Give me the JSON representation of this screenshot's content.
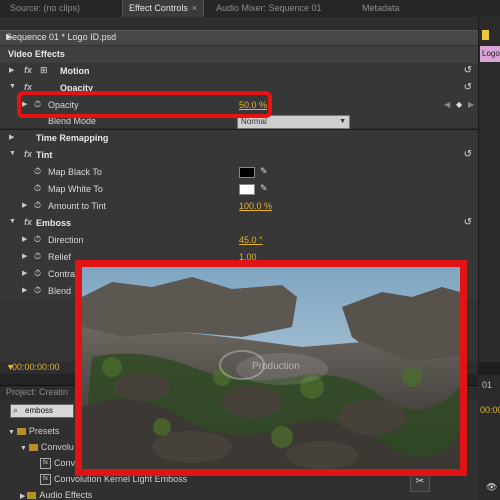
{
  "tabs": [
    {
      "label": "Source: (no clips)",
      "active": false
    },
    {
      "label": "Effect Controls",
      "active": true,
      "close": "×"
    },
    {
      "label": "Audio Mixer: Sequence 01",
      "active": false
    },
    {
      "label": "Metadata",
      "active": false
    }
  ],
  "sequence_header": {
    "label": "Sequence 01 * Logo ID.psd",
    "arrow": "▶"
  },
  "timeline_clip_label": "Logo",
  "video_effects_header": "Video Effects",
  "effects": {
    "motion": "Motion",
    "opacity_group": "Opacity",
    "opacity": {
      "label": "Opacity",
      "value": "50.0 %"
    },
    "blend_mode": {
      "label": "Blend Mode",
      "value": "Normal"
    },
    "time_remapping": "Time Remapping",
    "tint": "Tint",
    "map_black": "Map Black To",
    "map_white": "Map White To",
    "amount_to_tint": {
      "label": "Amount to Tint",
      "value": "100.0 %"
    },
    "emboss": "Emboss",
    "direction": {
      "label": "Direction",
      "value": "45.0 °"
    },
    "relief": {
      "label": "Relief",
      "value": "1.00"
    },
    "contrast": "Contra",
    "blend": "Blend"
  },
  "colors": {
    "accent_value": "#e9b528",
    "highlight": "#e81212",
    "map_black": "#000000",
    "map_white": "#ffffff"
  },
  "timecode": "00:00:00:00",
  "project_tab": "Project: Creatin",
  "search_value": "emboss",
  "project_tree": {
    "presets": "Presets",
    "convolution_folder": "Convolu",
    "convolution_item": "Convolu",
    "convolution_kernel": "Convolution Kernel Light Emboss",
    "audio_effects": "Audio Effects"
  },
  "right_panel": {
    "tab": "01",
    "timecode": "00:00"
  },
  "video_watermark": "Production",
  "icons": [
    "fx-icon",
    "stopwatch-icon",
    "reset-icon",
    "eyedropper-icon",
    "search-icon",
    "folder-icon",
    "triangle-icon",
    "keyframe-diamond-icon"
  ]
}
